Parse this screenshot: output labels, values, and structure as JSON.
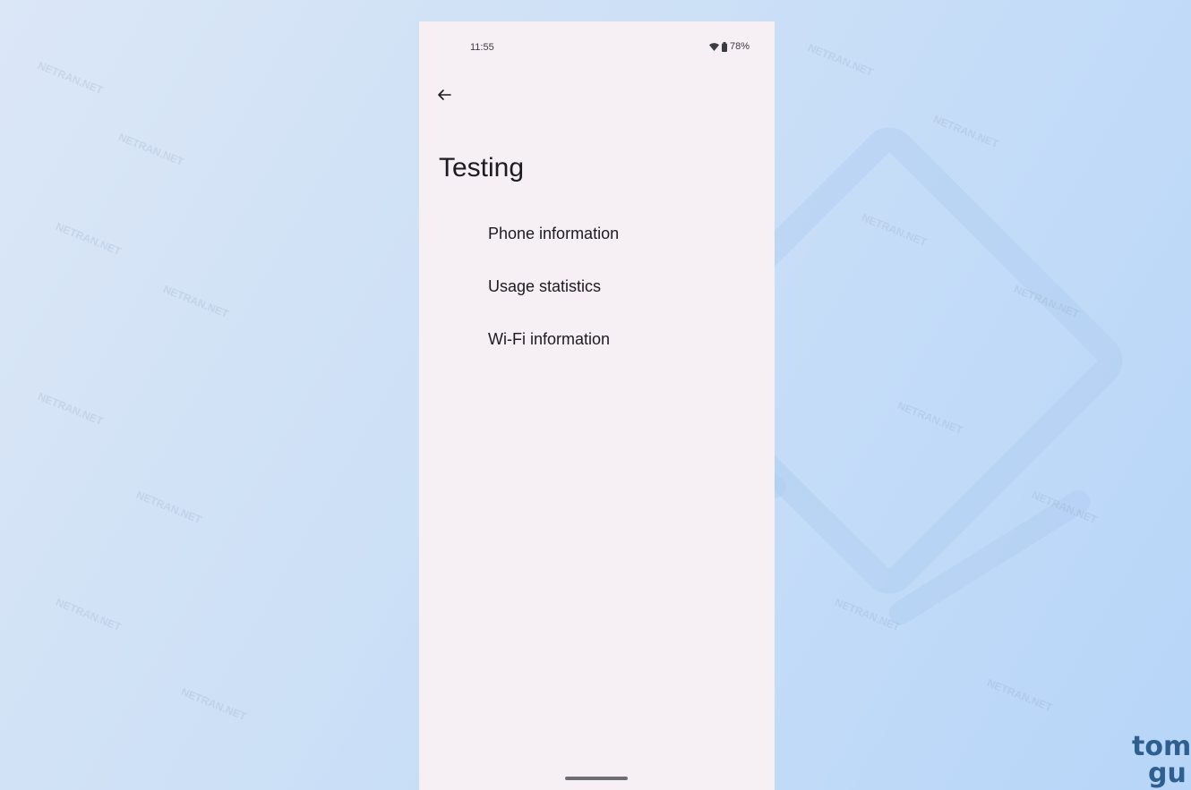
{
  "status_bar": {
    "time": "11:55",
    "battery_percent": "78%",
    "icons": [
      "wifi-icon",
      "battery-icon"
    ]
  },
  "header": {
    "back_icon": "arrow-left-icon"
  },
  "page": {
    "title": "Testing"
  },
  "menu": {
    "items": [
      {
        "label": "Phone information"
      },
      {
        "label": "Usage statistics"
      },
      {
        "label": "Wi-Fi information"
      }
    ]
  },
  "watermark": {
    "text": "NETRAN.NET"
  },
  "brand": {
    "line1": "tom",
    "line2": "gu"
  },
  "colors": {
    "screen_background": "#f6eff4",
    "text_primary": "#1c1b1f",
    "page_background": "#c4dcf8"
  }
}
